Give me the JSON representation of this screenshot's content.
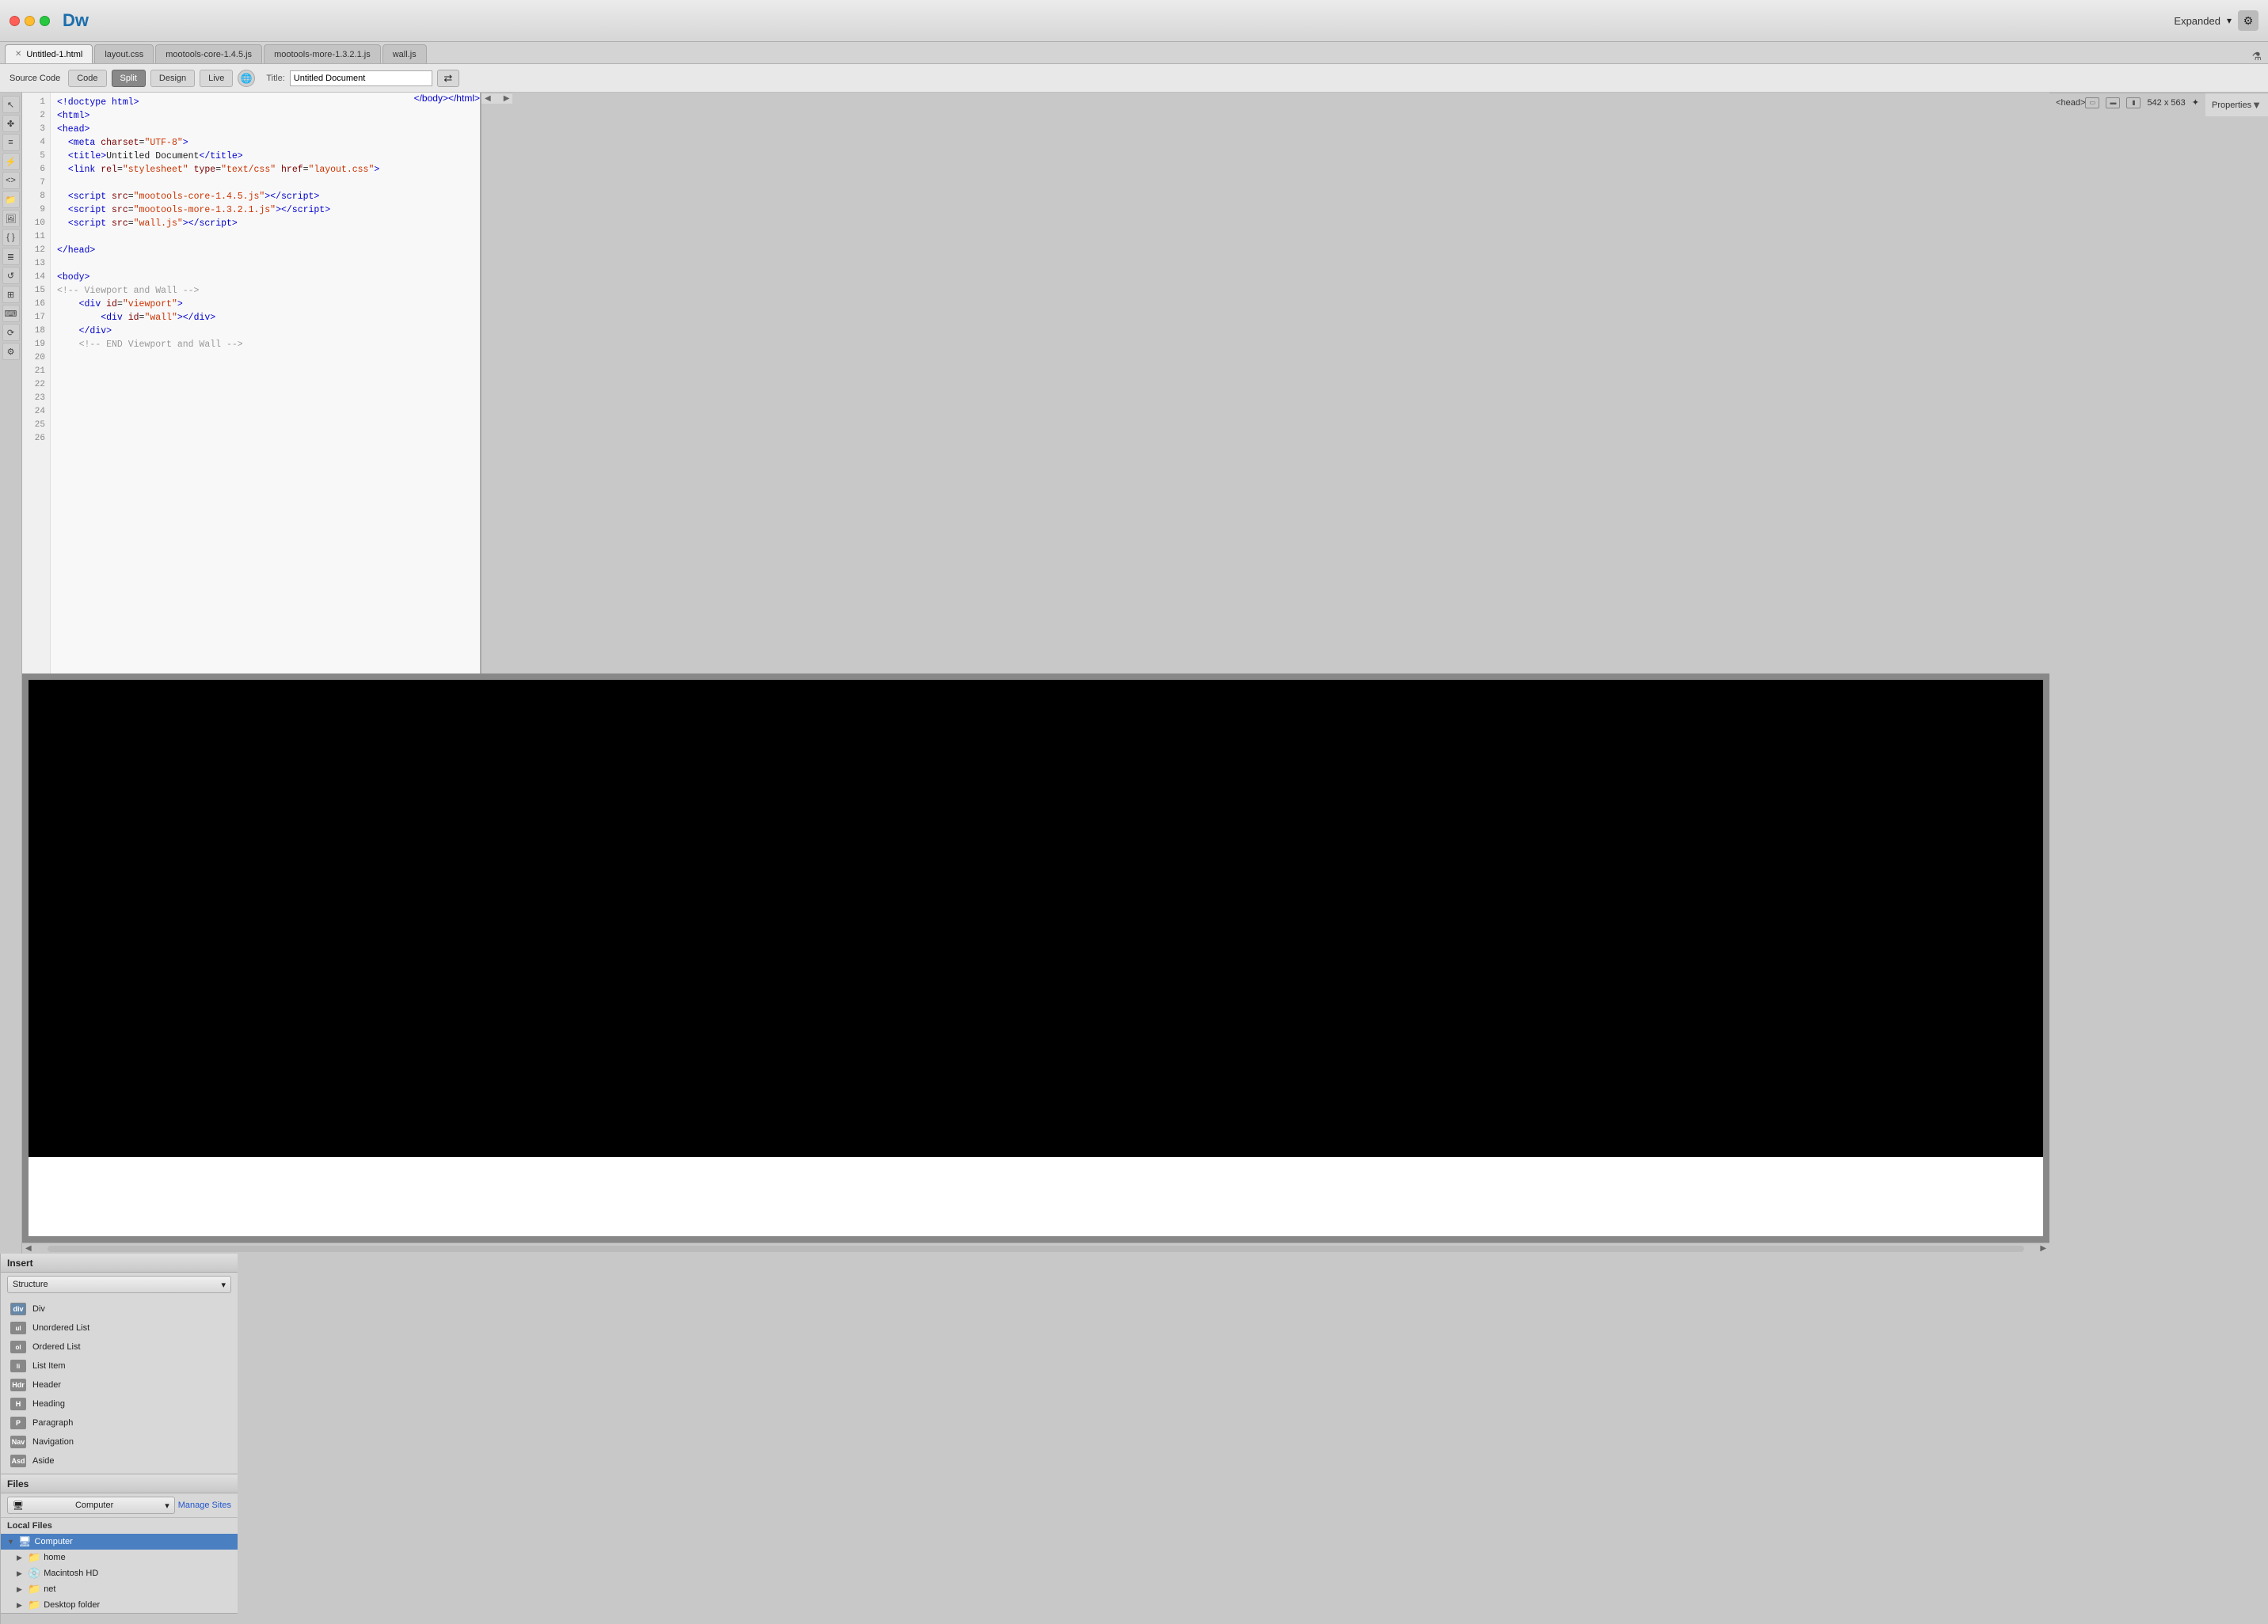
{
  "titlebar": {
    "app": "Dw",
    "expanded_label": "Expanded",
    "dropdown_arrow": "▾"
  },
  "file_tabs": [
    {
      "id": "untitled-1",
      "label": "Untitled-1.html",
      "active": true,
      "has_close": true
    },
    {
      "id": "layout-css",
      "label": "layout.css",
      "active": false
    },
    {
      "id": "mootools-core",
      "label": "mootools-core-1.4.5.js",
      "active": false
    },
    {
      "id": "mootools-more",
      "label": "mootools-more-1.3.2.1.js",
      "active": false
    },
    {
      "id": "wall-js",
      "label": "wall.js",
      "active": false
    }
  ],
  "toolbar": {
    "source_code_label": "Source Code",
    "view_buttons": [
      {
        "id": "code",
        "label": "Code",
        "active": false
      },
      {
        "id": "split",
        "label": "Split",
        "active": true
      },
      {
        "id": "design",
        "label": "Design",
        "active": false
      },
      {
        "id": "live",
        "label": "Live",
        "active": false
      }
    ],
    "title_label": "Title:",
    "title_value": "Untitled Document"
  },
  "code_editor": {
    "lines": [
      {
        "num": 1,
        "content": "<!doctype html>"
      },
      {
        "num": 2,
        "content": "<html>"
      },
      {
        "num": 3,
        "content": "<head>"
      },
      {
        "num": 4,
        "content": "  <meta charset=\"UTF-8\">"
      },
      {
        "num": 5,
        "content": "  <title>Untitled Document</title>"
      },
      {
        "num": 6,
        "content": "  <link rel=\"stylesheet\" type=\"text/css\" href=\"layout.css\">"
      },
      {
        "num": 7,
        "content": ""
      },
      {
        "num": 8,
        "content": "  <script src=\"mootools-core-1.4.5.js\"><\\/script>"
      },
      {
        "num": 9,
        "content": "  <script src=\"mootools-more-1.3.2.1.js\"><\\/script>"
      },
      {
        "num": 10,
        "content": "  <script src=\"wall.js\"><\\/script>"
      },
      {
        "num": 11,
        "content": ""
      },
      {
        "num": 12,
        "content": "</head>"
      },
      {
        "num": 13,
        "content": ""
      },
      {
        "num": 14,
        "content": "<body>"
      },
      {
        "num": 15,
        "content": "<!-- Viewport and Wall -->"
      },
      {
        "num": 16,
        "content": "    <div id=\"viewport\">"
      },
      {
        "num": 17,
        "content": "        <div id=\"wall\"></div>"
      },
      {
        "num": 18,
        "content": "    </div>"
      },
      {
        "num": 19,
        "content": "    <!-- END Viewport and Wall -->"
      },
      {
        "num": 20,
        "content": ""
      },
      {
        "num": 21,
        "content": ""
      },
      {
        "num": 22,
        "content": ""
      },
      {
        "num": 23,
        "content": ""
      },
      {
        "num": 24,
        "content": "</body>"
      },
      {
        "num": 25,
        "content": "</html>"
      },
      {
        "num": 26,
        "content": ""
      }
    ]
  },
  "status_bar": {
    "breadcrumb": "<head>",
    "dimensions": "542 x 563",
    "size_icons": [
      "▭",
      "▬",
      "▮"
    ]
  },
  "properties_bar": {
    "label": "Properties",
    "collapse_icon": "▼"
  },
  "insert_panel": {
    "title": "Insert",
    "category": "Structure",
    "items": [
      {
        "id": "div",
        "icon_label": "div",
        "label": "Div"
      },
      {
        "id": "ul",
        "icon_label": "ul",
        "label": "Unordered List"
      },
      {
        "id": "ol",
        "icon_label": "ol",
        "label": "Ordered List"
      },
      {
        "id": "li",
        "icon_label": "li",
        "label": "List Item"
      },
      {
        "id": "header",
        "icon_label": "hdr",
        "label": "Header"
      },
      {
        "id": "heading",
        "icon_label": "h",
        "label": "Heading"
      },
      {
        "id": "paragraph",
        "icon_label": "p",
        "label": "Paragraph"
      },
      {
        "id": "navigation",
        "icon_label": "nav",
        "label": "Navigation"
      },
      {
        "id": "aside",
        "icon_label": "asd",
        "label": "Aside"
      }
    ]
  },
  "files_panel": {
    "title": "Files",
    "location": "Computer",
    "manage_sites_label": "Manage Sites",
    "local_files_label": "Local Files",
    "tree": [
      {
        "id": "computer",
        "label": "Computer",
        "level": 0,
        "selected": true,
        "expanded": true,
        "has_arrow": true
      },
      {
        "id": "home",
        "label": "home",
        "level": 1,
        "selected": false,
        "expanded": false,
        "has_arrow": true
      },
      {
        "id": "mac-hd",
        "label": "Macintosh HD",
        "level": 1,
        "selected": false,
        "expanded": false,
        "has_arrow": true
      },
      {
        "id": "net",
        "label": "net",
        "level": 1,
        "selected": false,
        "expanded": false,
        "has_arrow": true
      },
      {
        "id": "desktop",
        "label": "Desktop folder",
        "level": 1,
        "selected": false,
        "expanded": false,
        "has_arrow": true
      }
    ]
  }
}
